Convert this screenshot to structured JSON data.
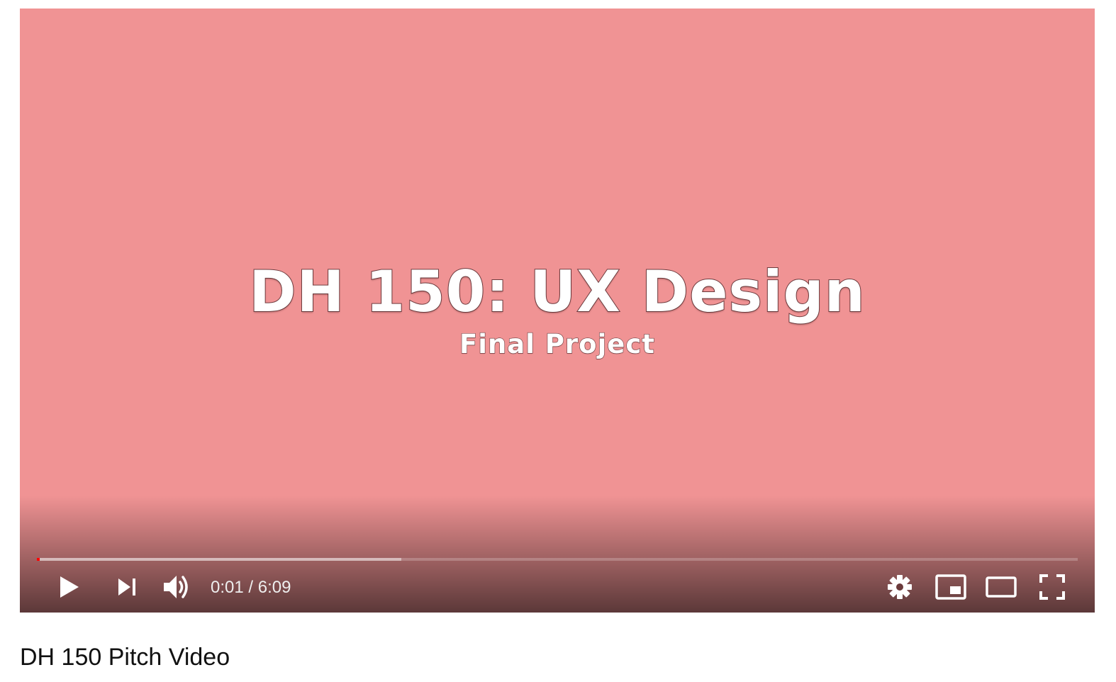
{
  "player": {
    "frame": {
      "title": "DH 150: UX Design",
      "subtitle": "Final Project",
      "background_color": "#f09394"
    },
    "progress": {
      "played_fraction": 0.003,
      "buffered_fraction": 0.35,
      "played_color": "#ff0000"
    },
    "controls": {
      "play_icon": "play-icon",
      "next_icon": "next-icon",
      "volume_icon": "volume-icon",
      "time": {
        "current": "0:01",
        "separator": "/",
        "duration": "6:09"
      },
      "settings_icon": "gear-icon",
      "miniplayer_icon": "miniplayer-icon",
      "theater_icon": "theater-mode-icon",
      "fullscreen_icon": "fullscreen-icon"
    }
  },
  "video": {
    "title": "DH 150 Pitch Video"
  }
}
